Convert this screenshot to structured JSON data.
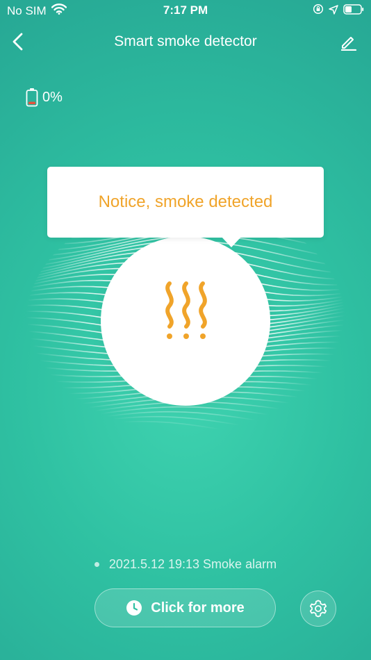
{
  "status_bar": {
    "carrier": "No SIM",
    "time": "7:17 PM",
    "icons": [
      "wifi-icon",
      "orientation-lock-icon",
      "location-icon",
      "battery-icon"
    ]
  },
  "nav": {
    "title": "Smart smoke detector",
    "back_icon": "chevron-left-icon",
    "edit_icon": "pencil-icon"
  },
  "device": {
    "battery_label": "0%",
    "battery_level": 0
  },
  "notice": {
    "text": "Notice, smoke detected"
  },
  "alarm": {
    "last_event": "2021.5.12 19:13 Smoke alarm"
  },
  "actions": {
    "more_label": "Click for more",
    "settings_icon": "gear-icon"
  },
  "colors": {
    "background": "#2fc1a2",
    "accent": "#f0a42a",
    "battery_low": "#e5533d"
  }
}
